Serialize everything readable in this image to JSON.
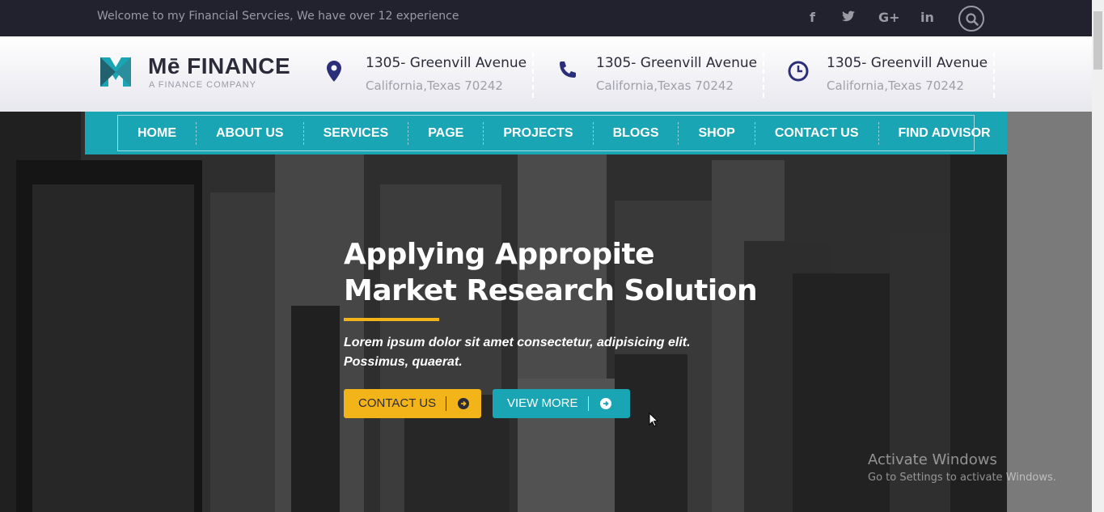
{
  "topbar": {
    "welcome": "Welcome to my Financial Servcies, We have over 12 experience",
    "social": [
      "f",
      "t",
      "G+",
      "in"
    ]
  },
  "logo": {
    "name": "Mē FINANCE",
    "tagline": "A FINANCE COMPANY"
  },
  "contacts": [
    {
      "icon": "map-pin-icon",
      "line1": "1305- Greenvill Avenue",
      "line2": "California,Texas 70242"
    },
    {
      "icon": "phone-icon",
      "line1": "1305- Greenvill Avenue",
      "line2": "California,Texas 70242"
    },
    {
      "icon": "clock-icon",
      "line1": "1305- Greenvill Avenue",
      "line2": "California,Texas 70242"
    }
  ],
  "nav": {
    "items": [
      "HOME",
      "ABOUT US",
      "SERVICES",
      "PAGE",
      "PROJECTS",
      "BLOGS",
      "SHOP",
      "CONTACT US",
      "FIND ADVISOR"
    ]
  },
  "hero": {
    "title_line1": "Applying Appropite",
    "title_line2": "Market Research Solution",
    "desc": "Lorem ipsum dolor sit amet consectetur, adipisicing elit. Possimus, quaerat.",
    "btn_contact": "CONTACT US",
    "btn_view": "VIEW MORE"
  },
  "watermark": {
    "line1": "Activate Windows",
    "line2": "Go to Settings to activate Windows."
  },
  "colors": {
    "teal": "#1aa5b5",
    "yellow": "#f3b419",
    "dark": "#22222f",
    "navy": "#2b2f7a"
  }
}
